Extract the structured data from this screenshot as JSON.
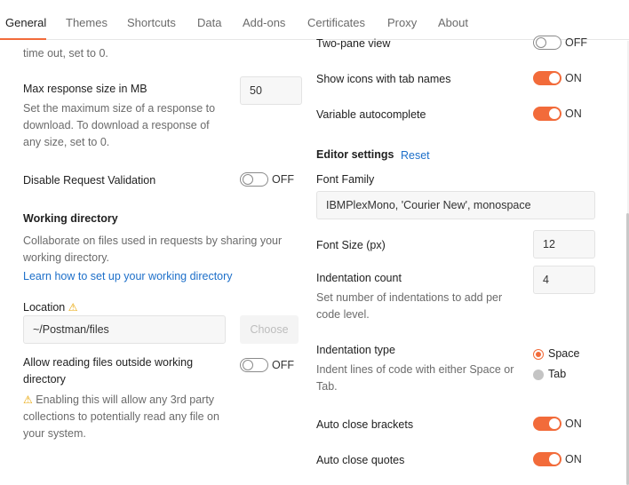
{
  "tabs": [
    {
      "label": "General"
    },
    {
      "label": "Themes"
    },
    {
      "label": "Shortcuts"
    },
    {
      "label": "Data"
    },
    {
      "label": "Add-ons"
    },
    {
      "label": "Certificates"
    },
    {
      "label": "Proxy"
    },
    {
      "label": "About"
    }
  ],
  "colors": {
    "accent": "#f26b3a",
    "link": "#1d6fc9",
    "warning": "#e8a400"
  },
  "left": {
    "timeout_help_partial": "time out, set to 0.",
    "max_response": {
      "label": "Max response size in MB",
      "value": "50",
      "help": "Set the maximum size of a response to download. To download a response of any size, set to 0."
    },
    "disable_validation": {
      "label": "Disable Request Validation",
      "state": "OFF"
    },
    "working_directory": {
      "heading": "Working directory",
      "help": "Collaborate on files used in requests by sharing your working directory.",
      "link": "Learn how to set up your working directory"
    },
    "location": {
      "label": "Location",
      "value": "~/Postman/files",
      "choose_label": "Choose",
      "icon": "warning-icon"
    },
    "allow_outside": {
      "label": "Allow reading files outside working directory",
      "state": "OFF",
      "warning": "Enabling this will allow any 3rd party collections to potentially read any file on your system."
    }
  },
  "right": {
    "two_pane": {
      "label": "Two-pane view",
      "state": "OFF"
    },
    "show_icons": {
      "label": "Show icons with tab names",
      "state": "ON"
    },
    "variable_autocomplete": {
      "label": "Variable autocomplete",
      "state": "ON"
    },
    "editor_settings": {
      "heading": "Editor settings",
      "reset": "Reset"
    },
    "font_family": {
      "label": "Font Family",
      "value": "IBMPlexMono, 'Courier New', monospace"
    },
    "font_size": {
      "label": "Font Size (px)",
      "value": "12"
    },
    "indentation_count": {
      "label": "Indentation count",
      "value": "4",
      "help": "Set number of indentations to add per code level."
    },
    "indentation_type": {
      "label": "Indentation type",
      "help": "Indent lines of code with either Space or Tab.",
      "options": [
        {
          "label": "Space",
          "selected": true
        },
        {
          "label": "Tab",
          "selected": false
        }
      ]
    },
    "auto_close_brackets": {
      "label": "Auto close brackets",
      "state": "ON"
    },
    "auto_close_quotes": {
      "label": "Auto close quotes",
      "state": "ON"
    }
  }
}
